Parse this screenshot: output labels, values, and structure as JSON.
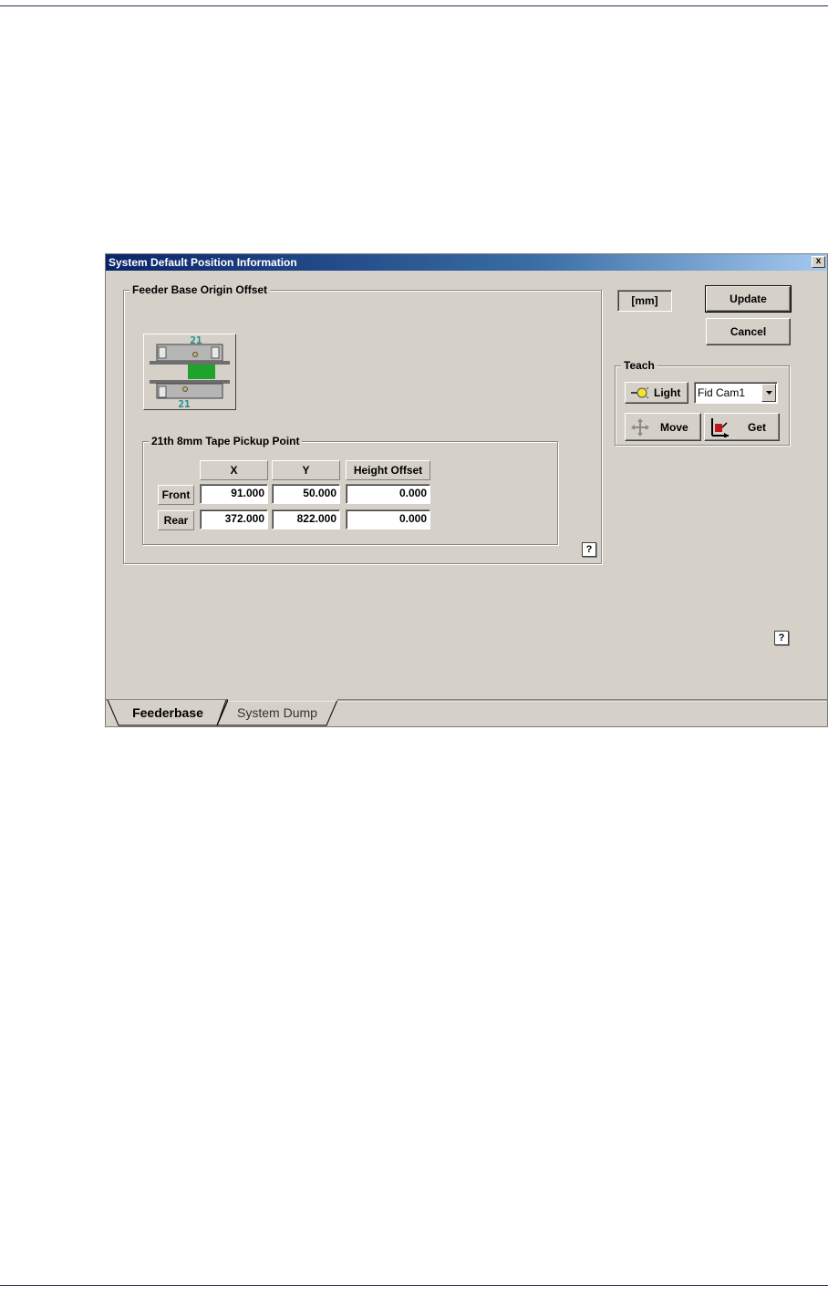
{
  "window": {
    "title": "System Default Position Information",
    "close_label": "x"
  },
  "feeder_group": {
    "label": "Feeder Base Origin Offset",
    "diagram_top_number": "21",
    "diagram_bottom_number": "21"
  },
  "pickup_group": {
    "label": "21th 8mm Tape Pickup Point",
    "columns": [
      "X",
      "Y",
      "Height Offset"
    ],
    "rows": [
      {
        "label": "Front",
        "values": [
          "91.000",
          "50.000",
          "0.000"
        ]
      },
      {
        "label": "Rear",
        "values": [
          "372.000",
          "822.000",
          "0.000"
        ]
      }
    ]
  },
  "units_label": "[mm]",
  "buttons": {
    "update": "Update",
    "cancel": "Cancel"
  },
  "teach": {
    "label": "Teach",
    "light_label": "Light",
    "camera_select": "Fid Cam1",
    "move_label": "Move",
    "get_label": "Get"
  },
  "help": "?",
  "tabs": [
    {
      "label": "Feederbase",
      "active": true
    },
    {
      "label": "System Dump",
      "active": false
    }
  ],
  "colors": {
    "window_bg": "#d5d1c8",
    "titlebar_start": "#0a246a",
    "titlebar_end": "#a6caf0",
    "diagram_green": "#1fa32d",
    "diagram_label": "#1f8e8e"
  }
}
